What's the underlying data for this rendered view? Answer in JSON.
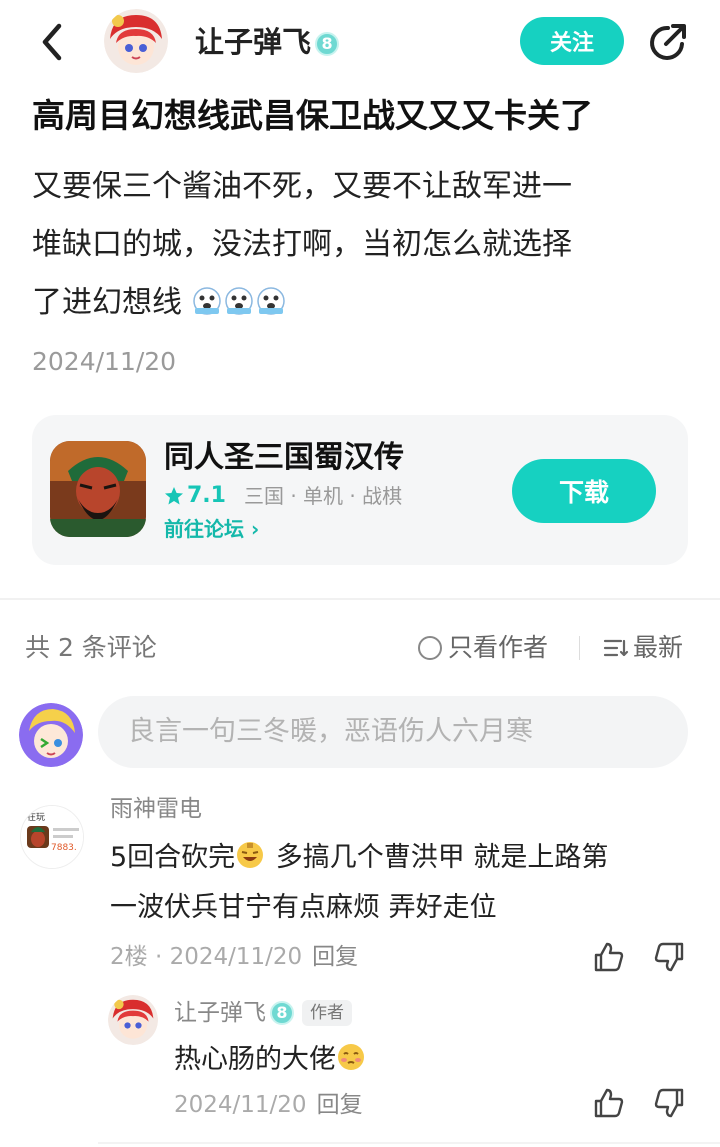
{
  "header": {
    "author_name": "让子弹飞",
    "level": "8",
    "follow_label": "关注"
  },
  "post": {
    "title": "高周目幻想线武昌保卫战又又又卡关了",
    "body_line1": "又要保三个酱油不死，又要不让敌军进一",
    "body_line2": "堆缺口的城，没法打啊，当初怎么就选择",
    "body_line3": "了进幻想线",
    "date": "2024/11/20"
  },
  "game_card": {
    "name": "同人圣三国蜀汉传",
    "rating": "7.1",
    "tags": "三国 · 单机 · 战棋",
    "forum_link": "前往论坛 ›",
    "download_label": "下载"
  },
  "comments_bar": {
    "count_label": "共 2 条评论",
    "author_only_label": "只看作者",
    "sort_label": "最新"
  },
  "comment_input": {
    "placeholder": "良言一句三冬暖，恶语伤人六月寒"
  },
  "comments": [
    {
      "author": "雨神雷电",
      "text_line1_a": "5回合砍完",
      "text_line1_b": " 多搞几个曹洪甲 就是上路第",
      "text_line2": "一波伏兵甘宁有点麻烦 弄好走位",
      "floor_date": "2楼 · 2024/11/20",
      "reply_label": "回复",
      "avatar_text": "在玩",
      "avatar_number": "7883."
    }
  ],
  "replies": [
    {
      "author": "让子弹飞",
      "level": "8",
      "tag": "作者",
      "text": "热心肠的大佬",
      "date": "2024/11/20",
      "reply_label": "回复"
    }
  ],
  "colors": {
    "accent": "#16d1c1",
    "muted": "#9a9a9a"
  }
}
